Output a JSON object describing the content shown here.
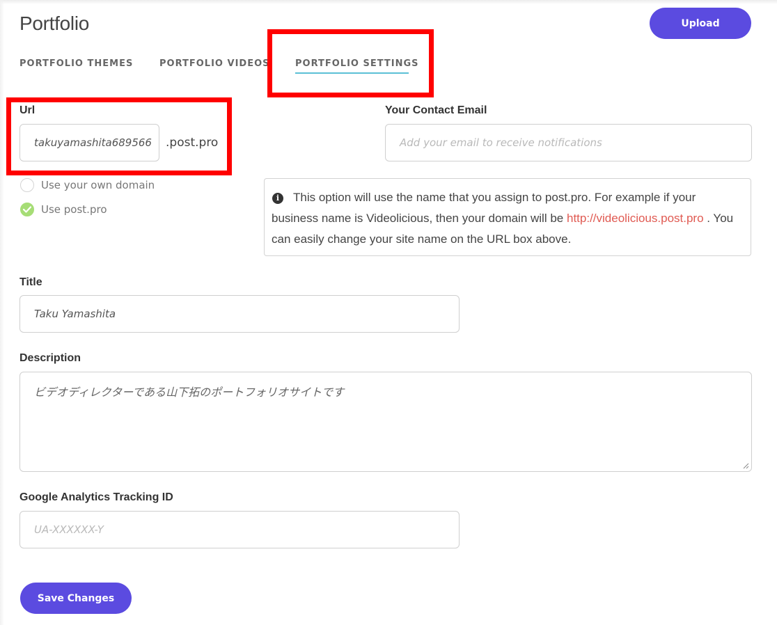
{
  "header": {
    "title": "Portfolio",
    "upload_label": "Upload"
  },
  "tabs": [
    {
      "label": "PORTFOLIO THEMES",
      "active": false
    },
    {
      "label": "PORTFOLIO VIDEOS",
      "active": false
    },
    {
      "label": "PORTFOLIO SETTINGS",
      "active": true
    }
  ],
  "url": {
    "label": "Url",
    "value": "takuyamashita689566",
    "suffix": ".post.pro"
  },
  "domain_options": [
    {
      "label": "Use your own domain",
      "checked": false
    },
    {
      "label": "Use post.pro",
      "checked": true
    }
  ],
  "contact_email": {
    "label": "Your Contact Email",
    "value": "",
    "placeholder": "Add your email to receive notifications"
  },
  "info": {
    "icon": "info-circle-icon",
    "text_before": "This option will use the name that you assign to post.pro. For example if your business name is Videolicious, then your domain will be ",
    "link": "http://videolicious.post.pro",
    "text_after": " . You can easily change your site name on the URL box above."
  },
  "title_field": {
    "label": "Title",
    "value": "Taku Yamashita"
  },
  "description": {
    "label": "Description",
    "value": "ビデオディレクターである山下拓のポートフォリオサイトです"
  },
  "analytics": {
    "label": "Google Analytics Tracking ID",
    "value": "",
    "placeholder": "UA-XXXXXX-Y"
  },
  "footer": {
    "save_label": "Save Changes"
  },
  "colors": {
    "primary_button": "#5b4be0",
    "tab_underline": "#5bc0d6",
    "highlight_box": "#ff0000",
    "radio_checked": "#a6dd76",
    "link": "#e05a52"
  }
}
